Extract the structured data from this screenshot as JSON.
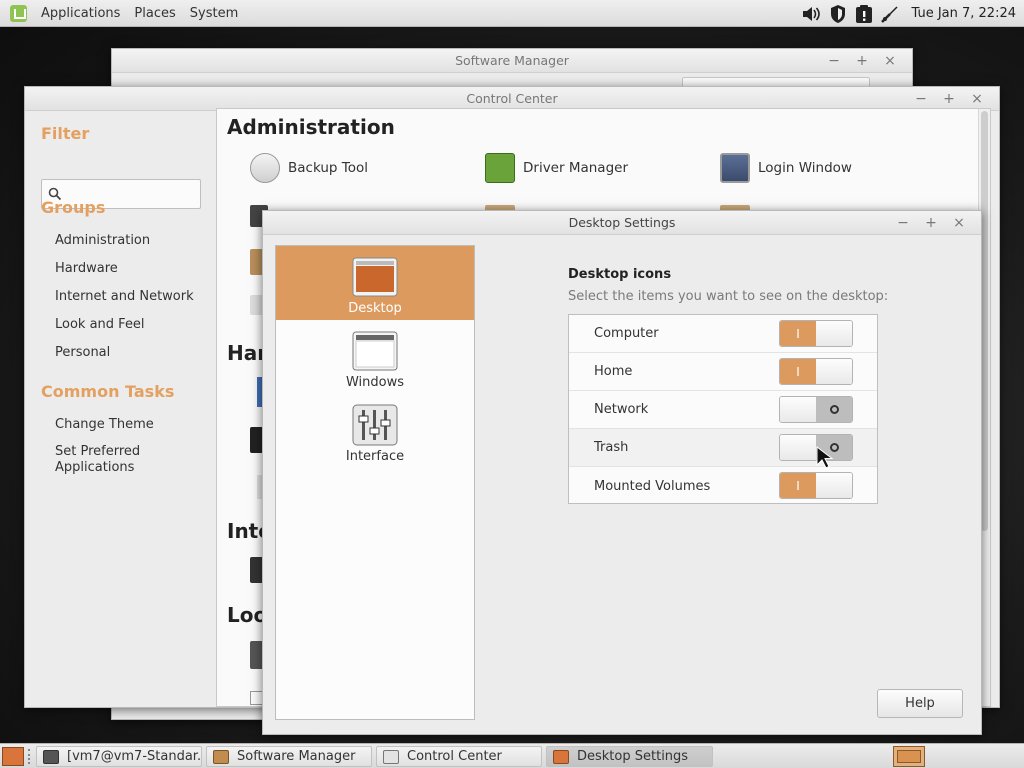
{
  "top_panel": {
    "menus": [
      "Applications",
      "Places",
      "System"
    ],
    "clock": "Tue Jan  7, 22:24",
    "tray_icons": [
      "volume-icon",
      "shield-icon",
      "update-icon",
      "network-icon"
    ]
  },
  "software_manager": {
    "title": "Software Manager"
  },
  "control_center": {
    "title": "Control Center",
    "filter_heading": "Filter",
    "search_placeholder": "",
    "groups_heading": "Groups",
    "groups": [
      "Administration",
      "Hardware",
      "Internet and Network",
      "Look and Feel",
      "Personal"
    ],
    "tasks_heading": "Common Tasks",
    "tasks": [
      "Change Theme",
      "Set Preferred Applications"
    ],
    "sections": [
      {
        "title": "Administration"
      },
      {
        "title": "Hard"
      },
      {
        "title": "Inte"
      },
      {
        "title": "Loo"
      }
    ],
    "admin_items": [
      {
        "label": "Backup Tool",
        "icon": "backup-icon"
      },
      {
        "label": "Driver Manager",
        "icon": "driver-icon"
      },
      {
        "label": "Login Window",
        "icon": "login-window-icon"
      }
    ]
  },
  "desktop_settings": {
    "title": "Desktop Settings",
    "categories": [
      {
        "label": "Desktop",
        "icon": "desktop-icon",
        "active": true
      },
      {
        "label": "Windows",
        "icon": "windows-icon",
        "active": false
      },
      {
        "label": "Interface",
        "icon": "interface-icon",
        "active": false
      }
    ],
    "heading": "Desktop icons",
    "description": "Select the items you want to see on the desktop:",
    "items": [
      {
        "label": "Computer",
        "on": true
      },
      {
        "label": "Home",
        "on": true
      },
      {
        "label": "Network",
        "on": false
      },
      {
        "label": "Trash",
        "on": false
      },
      {
        "label": "Mounted Volumes",
        "on": true
      }
    ],
    "switch_on_glyph": "I",
    "help_label": "Help"
  },
  "taskbar": {
    "tasks": [
      {
        "label": "[vm7@vm7-Standar...",
        "active": false
      },
      {
        "label": "Software Manager",
        "active": false
      },
      {
        "label": "Control Center",
        "active": false
      },
      {
        "label": "Desktop Settings",
        "active": true
      }
    ]
  },
  "colors": {
    "accent": "#dd9a5e",
    "heading_orange": "#e4a060"
  }
}
